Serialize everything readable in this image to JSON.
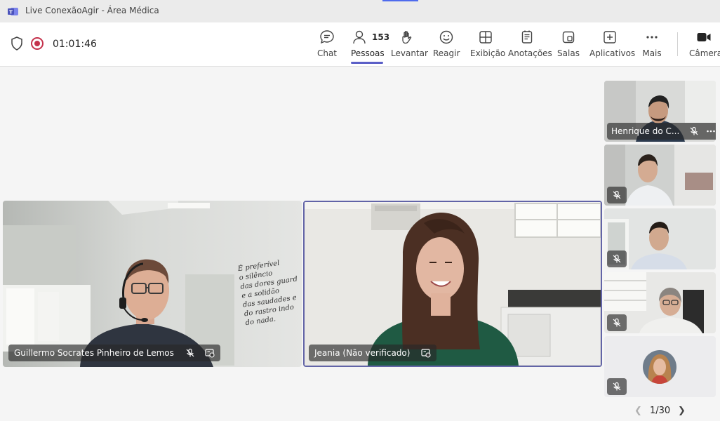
{
  "window": {
    "title": "Live ConexãoAgir - Área Médica"
  },
  "meeting": {
    "timer": "01:01:46"
  },
  "toolbar": {
    "chat": "Chat",
    "people": "Pessoas",
    "people_count": "153",
    "raise": "Levantar",
    "react": "Reagir",
    "view": "Exibição",
    "notes": "Anotações",
    "rooms": "Salas",
    "apps": "Aplicativos",
    "more": "Mais",
    "camera": "Câmera"
  },
  "main_tiles": [
    {
      "name": "Guillermo Socrates Pinheiro de Lemos"
    },
    {
      "name": "Jeania (Não verificado)"
    }
  ],
  "wall_text": [
    "É preferível",
    "o silêncio",
    "das dores guard",
    "e a solidão",
    "das saudades e",
    "do rastro indo",
    "do nada."
  ],
  "side_tiles": [
    {
      "name": "Henrique do C..."
    }
  ],
  "pagination": {
    "text": "1/30"
  },
  "colors": {
    "accent": "#5b5fc7",
    "record": "#c4314b",
    "active_border": "#6264a7"
  }
}
